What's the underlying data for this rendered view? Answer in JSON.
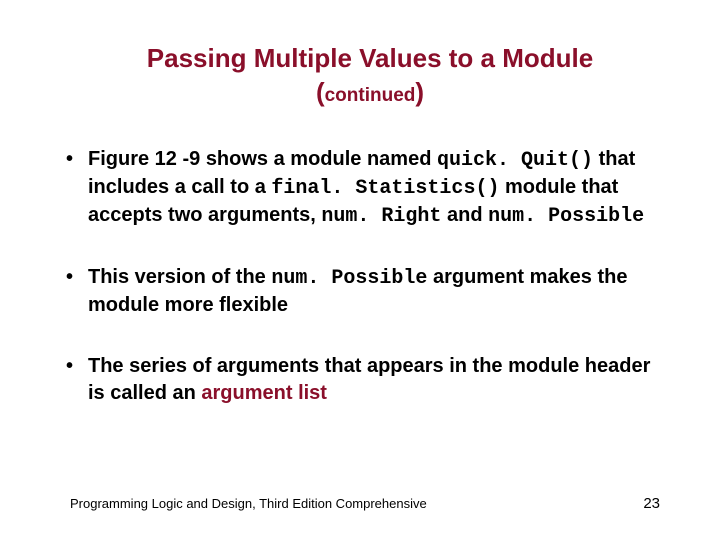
{
  "title": {
    "main": "Passing Multiple Values to a Module",
    "continued": "continued"
  },
  "bullets": [
    {
      "segments": [
        {
          "t": "Figure 12 -9 shows a module named ",
          "cls": ""
        },
        {
          "t": "quick. Quit()",
          "cls": "mono"
        },
        {
          "t": " that includes a call to a ",
          "cls": ""
        },
        {
          "t": "final. Statistics()",
          "cls": "mono"
        },
        {
          "t": " module that accepts two arguments, ",
          "cls": ""
        },
        {
          "t": "num. Right",
          "cls": "mono"
        },
        {
          "t": " and ",
          "cls": ""
        },
        {
          "t": "num. Possible",
          "cls": "mono"
        }
      ]
    },
    {
      "segments": [
        {
          "t": "This version of the ",
          "cls": ""
        },
        {
          "t": "num. Possible",
          "cls": "mono"
        },
        {
          "t": " argument makes the module more flexible",
          "cls": ""
        }
      ]
    },
    {
      "segments": [
        {
          "t": "The series of arguments that appears in the module header is called an ",
          "cls": ""
        },
        {
          "t": "argument list",
          "cls": "accent"
        }
      ]
    }
  ],
  "footer": {
    "text": "Programming Logic and Design, Third Edition Comprehensive",
    "page": "23"
  }
}
